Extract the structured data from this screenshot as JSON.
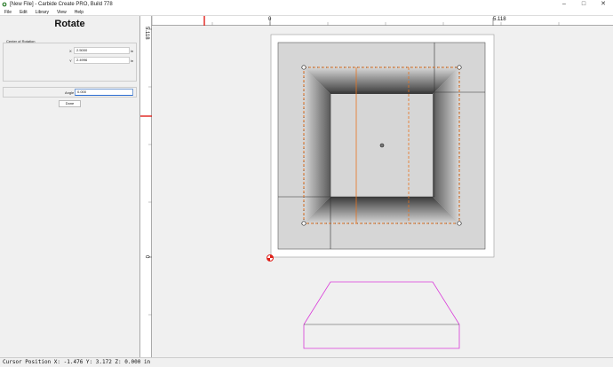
{
  "window": {
    "title": "[New File] - Carbide Create PRO, Build 778",
    "controls": {
      "minimize": "–",
      "maximize": "□",
      "close": "✕"
    }
  },
  "menu": [
    "File",
    "Edit",
    "Library",
    "View",
    "Help"
  ],
  "panel": {
    "title": "Rotate",
    "center_label": "Center of Rotation",
    "x_label": "X",
    "x_value": "2.5000",
    "y_label": "Y",
    "y_value": "2.4996",
    "unit": "in",
    "angle_label": "Angle",
    "angle_value": "0.000",
    "done_label": "Done"
  },
  "rulers": {
    "top_zero": "0",
    "top_max": "5.118",
    "left_max": "5.118",
    "left_zero": "0"
  },
  "status": "Cursor Position X: -1.476 Y: 3.172 Z: 0.000 in",
  "colors": {
    "accent_red": "#e0201a",
    "selection_orange": "#e8731e",
    "toolpath_magenta": "#d93bd9"
  }
}
